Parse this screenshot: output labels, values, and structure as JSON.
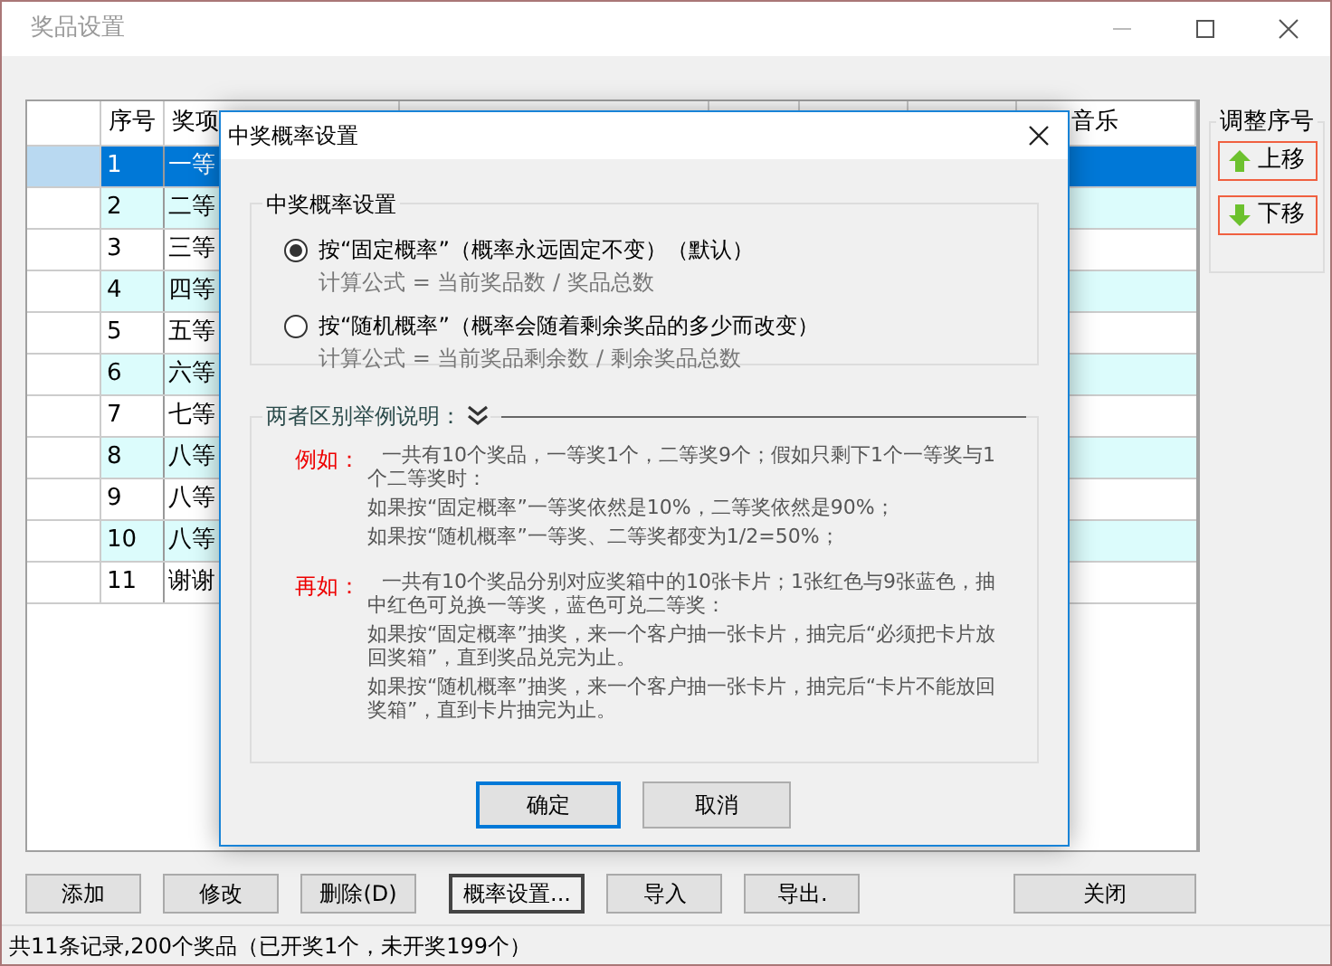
{
  "window": {
    "title": "奖品设置"
  },
  "table": {
    "columns": [
      "序号",
      "奖项",
      "音乐"
    ],
    "rows": [
      {
        "number": "1",
        "prize": "一等",
        "selected": true
      },
      {
        "number": "2",
        "prize": "二等",
        "selected": false
      },
      {
        "number": "3",
        "prize": "三等",
        "selected": false
      },
      {
        "number": "4",
        "prize": "四等",
        "selected": false
      },
      {
        "number": "5",
        "prize": "五等",
        "selected": false
      },
      {
        "number": "6",
        "prize": "六等",
        "selected": false
      },
      {
        "number": "7",
        "prize": "七等",
        "selected": false
      },
      {
        "number": "8",
        "prize": "八等",
        "selected": false
      },
      {
        "number": "9",
        "prize": "八等",
        "selected": false
      },
      {
        "number": "10",
        "prize": "八等",
        "selected": false
      },
      {
        "number": "11",
        "prize": "谢谢",
        "selected": false
      }
    ]
  },
  "order_panel": {
    "title": "调整序号",
    "buttons": [
      {
        "label": "上移",
        "kind": "up"
      },
      {
        "label": "下移",
        "kind": "down"
      }
    ]
  },
  "buttons": [
    {
      "label": "添加",
      "focused": false
    },
    {
      "label": "修改",
      "focused": false
    },
    {
      "label": "删除(D)",
      "focused": false
    },
    {
      "label": "概率设置...",
      "focused": true
    },
    {
      "label": "导入",
      "focused": false
    },
    {
      "label": "导出.",
      "focused": false
    }
  ],
  "close_button": "关闭",
  "status_bar": "共11条记录,200个奖品（已开奖1个，未开奖199个）",
  "dialog": {
    "title": "中奖概率设置",
    "group_title": "中奖概率设置",
    "options": [
      {
        "label": "按“固定概率”（概率永远固定不变）（默认）",
        "formula": "计算公式 = 当前奖品数 / 奖品总数",
        "selected": true
      },
      {
        "label": "按“随机概率”（概率会随着剩余奖品的多少而改变）",
        "formula": "计算公式 = 当前奖品剩余数 / 剩余奖品总数",
        "selected": false
      }
    ],
    "explain_title": "两者区别举例说明：",
    "examples": [
      {
        "label": "例如：",
        "lines": [
          "一共有10个奖品，一等奖1个，二等奖9个；假如只剩下1个一等奖与1个二等奖时：",
          "如果按“固定概率”一等奖依然是10%，二等奖依然是90%；",
          "如果按“随机概率”一等奖、二等奖都变为1/2=50%；"
        ]
      },
      {
        "label": "再如：",
        "lines": [
          "一共有10个奖品分别对应奖箱中的10张卡片；1张红色与9张蓝色，抽中红色可兑换一等奖，蓝色可兑二等奖：",
          "如果按“固定概率”抽奖，来一个客户抽一张卡片，抽完后“必须把卡片放回奖箱”，直到奖品兑完为止。",
          "如果按“随机概率”抽奖，来一个客户抽一张卡片，抽完后“卡片不能放回奖箱”，直到卡片抽完为止。"
        ]
      }
    ],
    "ok": "确定",
    "cancel": "取消"
  }
}
